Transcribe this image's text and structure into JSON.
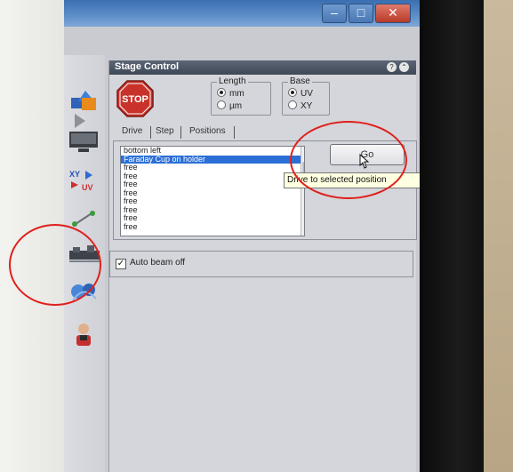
{
  "window": {
    "minimize_glyph": "–",
    "maximize_glyph": "□",
    "close_glyph": "✕"
  },
  "panel": {
    "title": "Stage Control",
    "stop_label": "STOP",
    "length": {
      "label": "Length",
      "options": [
        "mm",
        "µm"
      ],
      "selected": "mm"
    },
    "base": {
      "label": "Base",
      "options": [
        "UV",
        "XY"
      ],
      "selected": "UV"
    },
    "tabs": [
      "Drive",
      "Step",
      "Positions"
    ],
    "active_tab": "Positions",
    "positions": [
      "bottom left",
      "Faraday Cup on holder",
      "free",
      "free",
      "free",
      "free",
      "free",
      "free",
      "free",
      "free"
    ],
    "selected_position": "Faraday Cup on holder",
    "go_label": "Go",
    "tooltip": "Drive to selected position",
    "auto_beam_off": {
      "label": "Auto beam off",
      "checked": true,
      "check_glyph": "✓"
    }
  },
  "toolbar": {
    "uv_label": "UV",
    "xy_label": "XY"
  },
  "colors": {
    "annotation_ring": "#e0201c",
    "selection": "#2b6fd6",
    "stop_red": "#c8322a"
  }
}
